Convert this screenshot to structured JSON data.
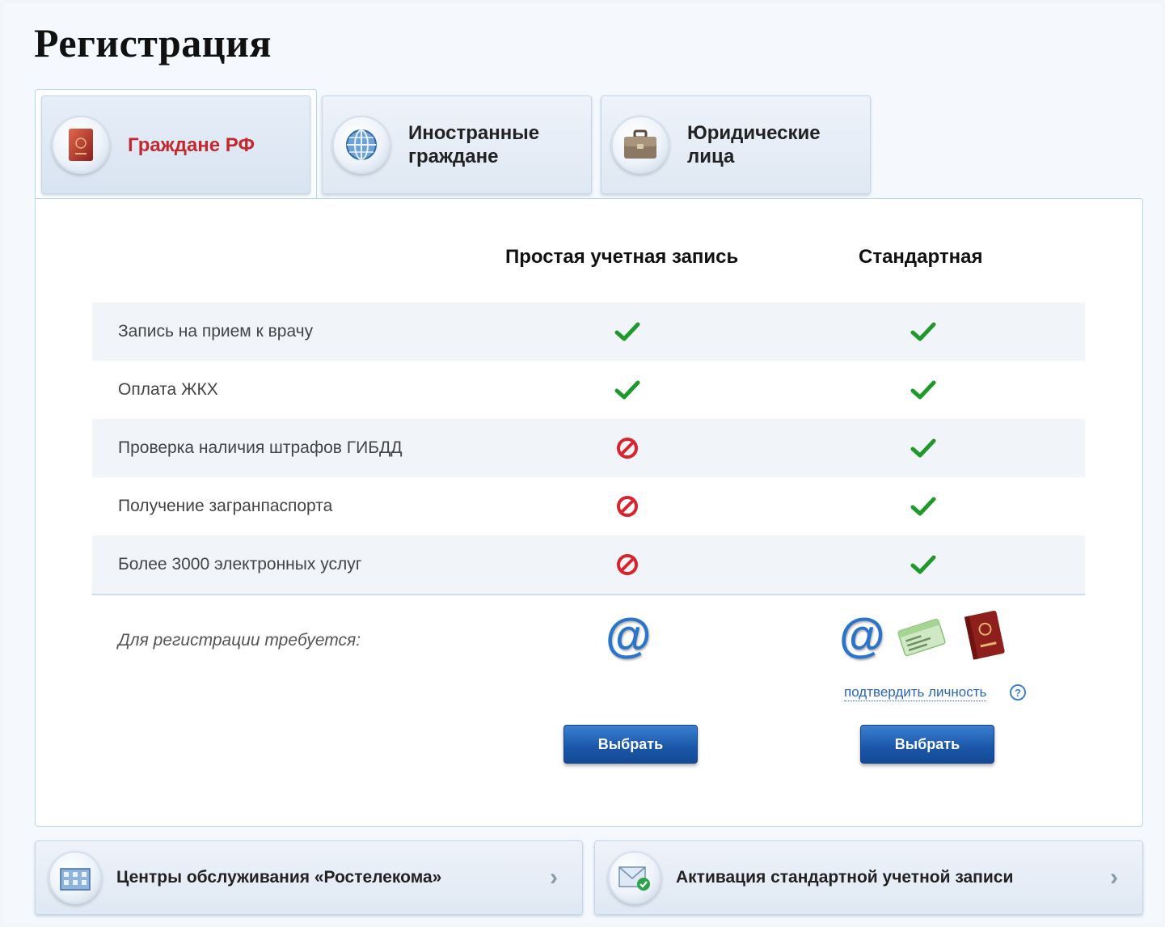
{
  "page": {
    "title": "Регистрация"
  },
  "tabs": [
    {
      "label": "Граждане РФ",
      "icon": "passport-icon",
      "active": true
    },
    {
      "label": "Иностранные граждане",
      "icon": "globe-icon",
      "active": false
    },
    {
      "label": "Юридические лица",
      "icon": "briefcase-icon",
      "active": false
    }
  ],
  "table": {
    "columns": [
      "Простая учетная запись",
      "Стандартная"
    ],
    "rows": [
      {
        "label": "Запись на прием к врачу",
        "simple": "check",
        "standard": "check"
      },
      {
        "label": "Оплата ЖКХ",
        "simple": "check",
        "standard": "check"
      },
      {
        "label": "Проверка наличия штрафов ГИБДД",
        "simple": "forbidden",
        "standard": "check"
      },
      {
        "label": "Получение загранпаспорта",
        "simple": "forbidden",
        "standard": "check"
      },
      {
        "label": "Более 3000 электронных услуг",
        "simple": "forbidden",
        "standard": "check"
      }
    ],
    "requirements_label": "Для регистрации требуется:",
    "requirements": {
      "simple": [
        "email-icon"
      ],
      "standard": [
        "email-icon",
        "snils-card-icon",
        "passport-icon"
      ]
    },
    "confirm_identity_link": "подтвердить личность",
    "help_glyph": "?",
    "select_button": "Выбрать"
  },
  "bottom_links": [
    {
      "label": "Центры обслуживания «Ростелекома»",
      "icon": "building-icon"
    },
    {
      "label": "Активация стандартной учетной записи",
      "icon": "mail-check-icon"
    }
  ],
  "colors": {
    "active_tab_text": "#c3282f",
    "check": "#1e9a2c",
    "forbidden": "#d9232d",
    "button": "#1a56a8",
    "link": "#2a67b3"
  }
}
